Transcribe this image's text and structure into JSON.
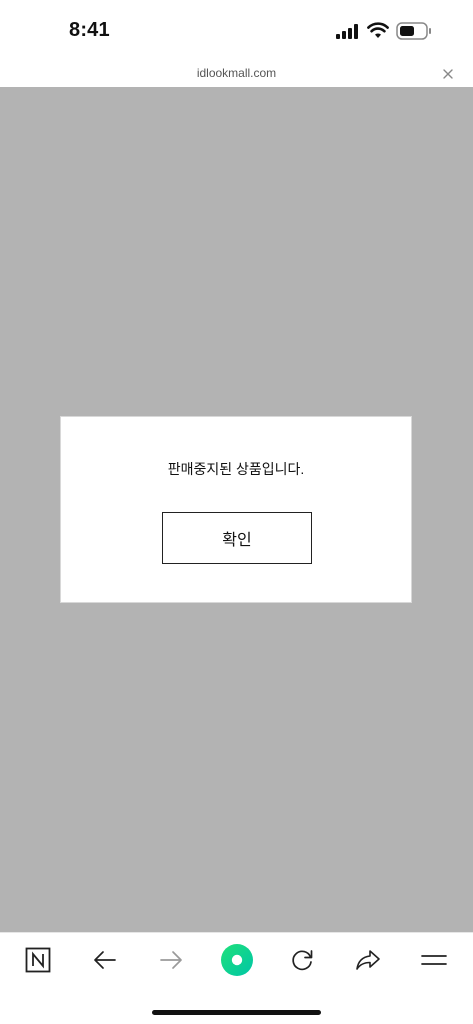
{
  "status_bar": {
    "time": "8:41"
  },
  "browser": {
    "url": "idlookmall.com"
  },
  "dialog": {
    "message": "판매중지된 상품입니다.",
    "confirm_label": "확인"
  },
  "toolbar": {
    "items": [
      "naver-home",
      "back",
      "forward",
      "green-dot",
      "reload",
      "share",
      "menu"
    ]
  },
  "colors": {
    "overlay": "#b3b3b3",
    "accent_green": "#03c75a"
  }
}
